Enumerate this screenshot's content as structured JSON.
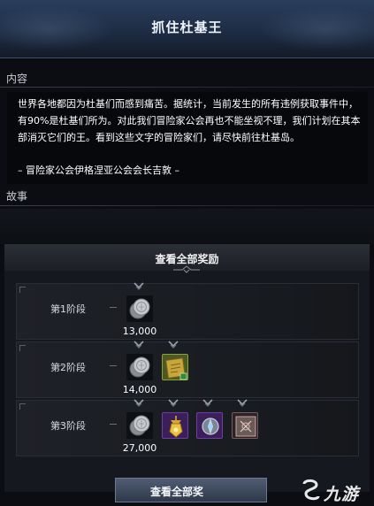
{
  "window": {
    "title": "抓住杜基王"
  },
  "sections": {
    "content_label": "内容",
    "story_label": "故事"
  },
  "content": {
    "body": "世界各地都因为杜基们而感到痛苦。据统计，当前发生的所有违例获取事件中，有90%是杜基们所为。对此我们冒险家公会再也不能坐视不理，我们计划在其本部消灭它们的王。看到这些文字的冒险家们，请尽快前往杜基岛。",
    "signature": "– 冒险家公会伊格涅亚公会会长吉敦 –"
  },
  "rewards": {
    "header": "查看全部奖励",
    "stages": [
      {
        "label": "第1阶段",
        "coin_amount": "13,000",
        "items": [
          "silver-coin"
        ]
      },
      {
        "label": "第2阶段",
        "coin_amount": "14,000",
        "items": [
          "silver-coin",
          "gold-map-scroll"
        ]
      },
      {
        "label": "第3阶段",
        "coin_amount": "27,000",
        "items": [
          "silver-coin",
          "gold-amulet",
          "crystal-orb",
          "cracked-stone"
        ]
      }
    ]
  },
  "bottom_button": {
    "label": "查看全部奖"
  },
  "watermark": {
    "text": "九游"
  },
  "colors": {
    "title_bar": "#24364f",
    "panel": "#15181e",
    "rare_purple": "#3a1f5a",
    "gold": "#c9a63a"
  }
}
